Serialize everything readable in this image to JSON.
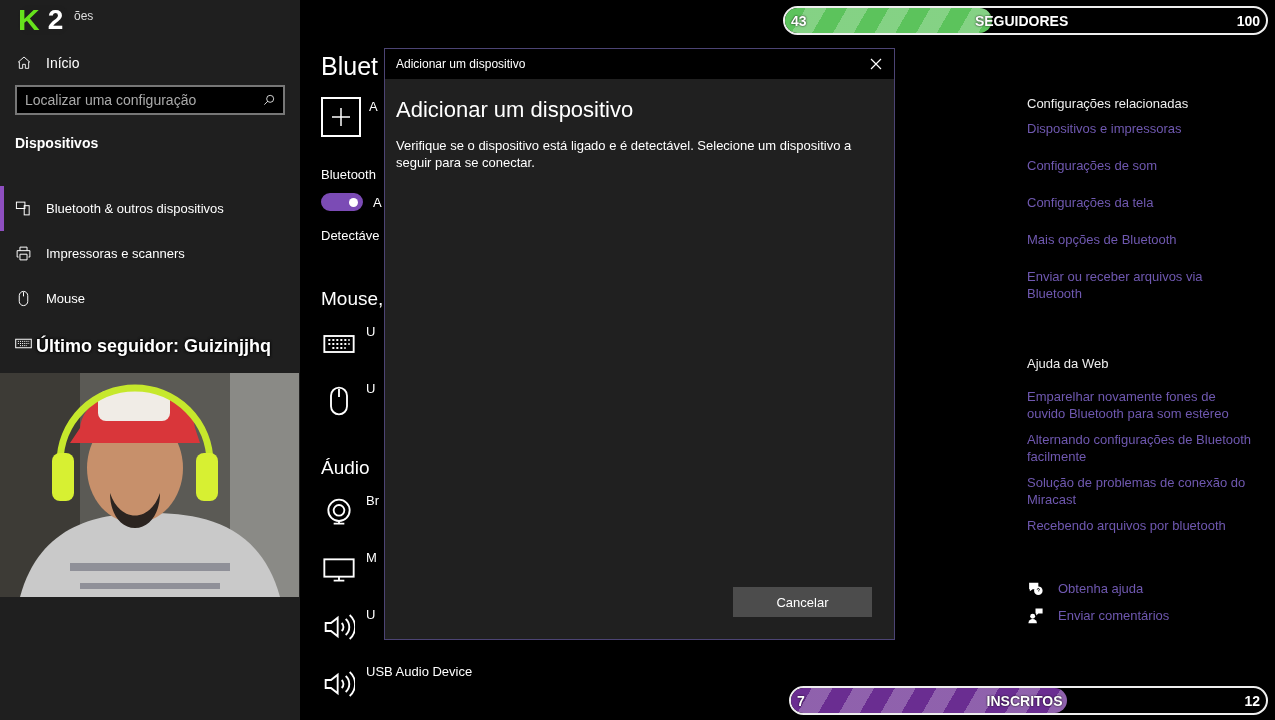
{
  "window": {
    "title": "ões"
  },
  "logo": [
    "K",
    "2"
  ],
  "sidebar": {
    "home": "Início",
    "search": {
      "placeholder": "Localizar uma configuração"
    },
    "section": "Dispositivos",
    "items": [
      {
        "label": "Bluetooth & outros dispositivos",
        "selected": true,
        "kind": "bluetooth"
      },
      {
        "label": "Impressoras e scanners",
        "selected": false,
        "kind": "printer"
      },
      {
        "label": "Mouse",
        "selected": false,
        "kind": "mouse"
      },
      {
        "kind": "keyboard",
        "selected": false
      }
    ]
  },
  "main": {
    "title": "Bluet",
    "add_label": "A",
    "bluetooth_label": "Bluetooth",
    "toggle": {
      "on": true,
      "label": "A"
    },
    "discoverable": "Detectáve",
    "sections": [
      {
        "heading": "Mouse,",
        "devices": [
          {
            "kind": "keyboard",
            "name": "U"
          },
          {
            "kind": "mouse",
            "name": "U"
          }
        ]
      },
      {
        "heading": "Áudio",
        "devices": [
          {
            "kind": "webcam",
            "name": "Br"
          },
          {
            "kind": "monitor",
            "name": "M"
          },
          {
            "kind": "speaker",
            "name": "U"
          },
          {
            "kind": "speaker",
            "name": "USB Audio Device"
          }
        ]
      }
    ]
  },
  "related": {
    "heading": "Configurações relacionadas",
    "links": [
      "Dispositivos e impressoras",
      "Configurações de som",
      "Configurações da tela",
      "Mais opções de Bluetooth",
      "Enviar ou receber arquivos via Bluetooth"
    ]
  },
  "web_help": {
    "heading": "Ajuda da Web",
    "links": [
      "Emparelhar novamente fones de ouvido Bluetooth para som estéreo",
      "Alternando configurações de Bluetooth facilmente",
      "Solução de problemas de conexão do Miracast",
      "Recebendo arquivos por bluetooth"
    ]
  },
  "help_actions": [
    {
      "kind": "help",
      "label": "Obtenha ajuda"
    },
    {
      "kind": "feedback",
      "label": "Enviar comentários"
    }
  ],
  "dialog": {
    "window_title": "Adicionar um dispositivo",
    "heading": "Adicionar um dispositivo",
    "description": "Verifique se o dispositivo está ligado e é detectável. Selecione um dispositivo a seguir para se conectar.",
    "button": "Cancelar"
  },
  "last_follower": "Último seguidor: Guizinjjhq",
  "goals": [
    {
      "start": "43",
      "label": "SEGUIDORES",
      "end": "100",
      "level": 0.43,
      "color": "#5cc35c"
    },
    {
      "start": "7",
      "label": "INSCRITOS",
      "end": "12",
      "level": 0.58,
      "color": "#6a2d91"
    }
  ]
}
